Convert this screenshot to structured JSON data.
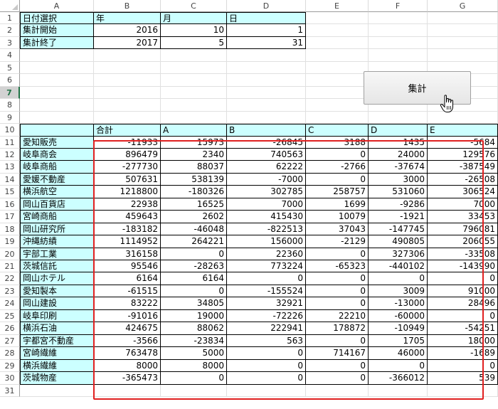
{
  "columns": [
    "A",
    "B",
    "C",
    "D",
    "E",
    "F",
    "G"
  ],
  "rows": [
    "1",
    "2",
    "3",
    "4",
    "5",
    "6",
    "7",
    "8",
    "9",
    "10",
    "11",
    "12",
    "13",
    "14",
    "15",
    "16",
    "17",
    "18",
    "19",
    "20",
    "21",
    "22",
    "23",
    "24",
    "25",
    "26",
    "27",
    "28",
    "29",
    "30",
    "31"
  ],
  "selected_row": "7",
  "date_selection": {
    "title": "日付選択",
    "headers": [
      "年",
      "月",
      "日"
    ],
    "start": {
      "label": "集計開始",
      "year": "2016",
      "month": "10",
      "day": "1"
    },
    "end": {
      "label": "集計終了",
      "year": "2017",
      "month": "5",
      "day": "31"
    }
  },
  "aggregate_button": {
    "label": "集計"
  },
  "table": {
    "headers": [
      "合計",
      "A",
      "B",
      "C",
      "D",
      "E"
    ],
    "rows": [
      {
        "name": "愛知販売",
        "values": [
          "-11933",
          "15973",
          "-26845",
          "3188",
          "1435",
          "-5684"
        ]
      },
      {
        "name": "岐阜商会",
        "values": [
          "896479",
          "2340",
          "740563",
          "0",
          "24000",
          "129576"
        ]
      },
      {
        "name": "岐阜商船",
        "values": [
          "-277730",
          "88037",
          "62222",
          "-2766",
          "-37674",
          "-387549"
        ]
      },
      {
        "name": "愛媛不動産",
        "values": [
          "507631",
          "538139",
          "-7000",
          "0",
          "3000",
          "-26508"
        ]
      },
      {
        "name": "横浜航空",
        "values": [
          "1218800",
          "-180326",
          "302785",
          "258757",
          "531060",
          "306524"
        ]
      },
      {
        "name": "岡山百貨店",
        "values": [
          "22938",
          "16525",
          "7000",
          "1699",
          "-9286",
          "7000"
        ]
      },
      {
        "name": "宮崎商船",
        "values": [
          "459643",
          "2602",
          "415430",
          "10079",
          "-1921",
          "33453"
        ]
      },
      {
        "name": "岡山研究所",
        "values": [
          "-183182",
          "-46048",
          "-822513",
          "37043",
          "-147745",
          "796081"
        ]
      },
      {
        "name": "沖縄紡績",
        "values": [
          "1114952",
          "264221",
          "156000",
          "-2129",
          "490805",
          "206055"
        ]
      },
      {
        "name": "宇部工業",
        "values": [
          "316158",
          "0",
          "22360",
          "0",
          "327306",
          "-33508"
        ]
      },
      {
        "name": "茨城信託",
        "values": [
          "95546",
          "-28263",
          "773224",
          "-65323",
          "-440102",
          "-143990"
        ]
      },
      {
        "name": "岡山ホテル",
        "values": [
          "6164",
          "6164",
          "0",
          "0",
          "0",
          "0"
        ]
      },
      {
        "name": "愛知製本",
        "values": [
          "-61515",
          "0",
          "-155524",
          "0",
          "3009",
          "91000"
        ]
      },
      {
        "name": "岡山建設",
        "values": [
          "83222",
          "34805",
          "32921",
          "0",
          "-13000",
          "28496"
        ]
      },
      {
        "name": "岐阜印刷",
        "values": [
          "-91016",
          "19000",
          "-72226",
          "22210",
          "-60000",
          "0"
        ]
      },
      {
        "name": "横浜石油",
        "values": [
          "424675",
          "88062",
          "222941",
          "178872",
          "-10949",
          "-54251"
        ]
      },
      {
        "name": "宇都宮不動産",
        "values": [
          "-3566",
          "-23834",
          "563",
          "0",
          "1705",
          "18000"
        ]
      },
      {
        "name": "宮崎繊維",
        "values": [
          "763478",
          "5000",
          "0",
          "714167",
          "46000",
          "-1689"
        ]
      },
      {
        "name": "横浜繊維",
        "values": [
          "8000",
          "8000",
          "0",
          "0",
          "0",
          "0"
        ]
      },
      {
        "name": "茨城物産",
        "values": [
          "-365473",
          "0",
          "0",
          "0",
          "-366012",
          "539"
        ]
      }
    ]
  },
  "colors": {
    "header_fill": "#ccffff",
    "highlight_border": "#e02020",
    "selected_row": "#217346"
  }
}
